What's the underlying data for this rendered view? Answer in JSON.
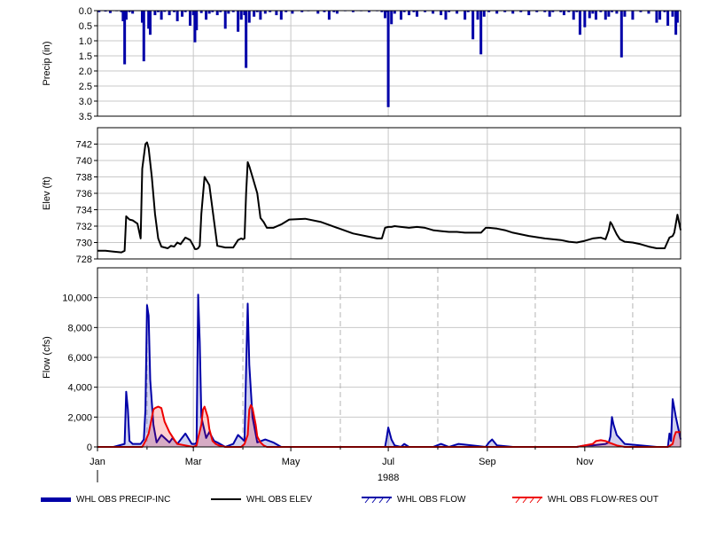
{
  "chart_data": {
    "type": "line",
    "x_axis": {
      "year_label": "1988",
      "tick_labels": [
        "Jan",
        "Mar",
        "May",
        "Jul",
        "Sep",
        "Nov"
      ],
      "tick_days": [
        0,
        60,
        121,
        182,
        244,
        305
      ],
      "minor_tick_days": [
        31,
        91,
        152,
        213,
        274,
        335
      ],
      "range_days": [
        0,
        365
      ]
    },
    "panels": [
      {
        "id": "precip",
        "ylabel": "Precip (in)",
        "ylim": [
          0,
          3.5
        ],
        "inverted": true,
        "yticks": [
          "0.0",
          "0.5",
          "1.0",
          "1.5",
          "2.0",
          "2.5",
          "3.0",
          "3.5"
        ],
        "ytick_values": [
          0,
          0.5,
          1,
          1.5,
          2,
          2.5,
          3,
          3.5
        ],
        "grid": true,
        "series": [
          {
            "name": "WHL OBS PRECIP-INC",
            "color": "#0000a8",
            "kind": "bar",
            "x": [
              1,
              5,
              8,
              12,
              15,
              16,
              17,
              18,
              20,
              22,
              28,
              29,
              32,
              33,
              36,
              38,
              40,
              42,
              45,
              48,
              50,
              53,
              55,
              58,
              60,
              61,
              62,
              65,
              68,
              70,
              72,
              75,
              77,
              80,
              82,
              85,
              88,
              90,
              92,
              93,
              95,
              98,
              100,
              102,
              105,
              108,
              112,
              115,
              118,
              122,
              128,
              132,
              138,
              142,
              145,
              148,
              150,
              155,
              160,
              165,
              170,
              175,
              178,
              180,
              181,
              182,
              184,
              186,
              190,
              192,
              195,
              198,
              200,
              205,
              210,
              215,
              218,
              220,
              225,
              230,
              232,
              235,
              238,
              240,
              242,
              245,
              250,
              255,
              260,
              265,
              270,
              275,
              280,
              283,
              285,
              290,
              292,
              295,
              298,
              300,
              302,
              305,
              308,
              310,
              312,
              315,
              318,
              320,
              322,
              325,
              328,
              330,
              335,
              340,
              345,
              350,
              352,
              355,
              357,
              360,
              362,
              363
            ],
            "y": [
              0.05,
              0.03,
              0.08,
              0.02,
              0.05,
              0.35,
              1.78,
              0.3,
              0.05,
              0.1,
              0.4,
              1.68,
              0.6,
              0.8,
              0.15,
              0.05,
              0.3,
              0.04,
              0.15,
              0.05,
              0.35,
              0.2,
              0.05,
              0.5,
              0.15,
              1.05,
              0.65,
              0.08,
              0.3,
              0.1,
              0.05,
              0.15,
              0.05,
              0.6,
              0.1,
              0.05,
              0.7,
              0.3,
              0.15,
              1.9,
              0.4,
              0.2,
              0.05,
              0.3,
              0.1,
              0.05,
              0.15,
              0.3,
              0.05,
              0.1,
              0.05,
              0.02,
              0.1,
              0.05,
              0.3,
              0.05,
              0.1,
              0.02,
              0.05,
              0.02,
              0.05,
              0.02,
              0.05,
              0.25,
              0.05,
              3.2,
              0.45,
              0.1,
              0.3,
              0.05,
              0.15,
              0.05,
              0.2,
              0.05,
              0.1,
              0.15,
              0.3,
              0.05,
              0.1,
              0.3,
              0.05,
              0.95,
              0.3,
              1.45,
              0.2,
              0.05,
              0.1,
              0.05,
              0.1,
              0.05,
              0.15,
              0.05,
              0.05,
              0.2,
              0.05,
              0.05,
              0.15,
              0.05,
              0.3,
              0.05,
              0.8,
              0.55,
              0.25,
              0.1,
              0.3,
              0.05,
              0.3,
              0.2,
              0.05,
              0.1,
              1.55,
              0.2,
              0.3,
              0.05,
              0.1,
              0.4,
              0.3,
              0.05,
              0.5,
              0.2,
              0.8,
              0.4,
              0.2,
              0.15
            ]
          }
        ]
      },
      {
        "id": "elev",
        "ylabel": "Elev (ft)",
        "ylim": [
          728,
          744
        ],
        "yticks": [
          "728",
          "730",
          "732",
          "734",
          "736",
          "738",
          "740",
          "742"
        ],
        "ytick_values": [
          728,
          730,
          732,
          734,
          736,
          738,
          740,
          742
        ],
        "grid": true,
        "series": [
          {
            "name": "WHL OBS ELEV",
            "color": "#000000",
            "kind": "line",
            "x": [
              0,
              5,
              10,
              15,
              17,
              18,
              20,
              22,
              25,
              27,
              28,
              30,
              31,
              32,
              34,
              36,
              38,
              40,
              44,
              46,
              48,
              50,
              52,
              55,
              58,
              60,
              61,
              62,
              63,
              64,
              65,
              67,
              70,
              75,
              80,
              83,
              85,
              88,
              90,
              91,
              92,
              93,
              94,
              95,
              97,
              100,
              102,
              104,
              106,
              110,
              115,
              120,
              130,
              140,
              150,
              160,
              170,
              175,
              178,
              180,
              182,
              184,
              186,
              190,
              195,
              200,
              205,
              210,
              215,
              220,
              225,
              230,
              240,
              243,
              245,
              250,
              255,
              260,
              270,
              280,
              290,
              295,
              300,
              305,
              310,
              315,
              318,
              320,
              321,
              322,
              323,
              325,
              327,
              330,
              335,
              340,
              345,
              350,
              355,
              358,
              360,
              361,
              363,
              365
            ],
            "y": [
              729.0,
              729.0,
              728.9,
              728.8,
              729.0,
              733.2,
              732.8,
              732.7,
              732.3,
              730.5,
              739.0,
              742.0,
              742.2,
              741.5,
              738.0,
              733.5,
              730.5,
              729.5,
              729.3,
              729.6,
              729.5,
              730.0,
              729.8,
              730.6,
              730.3,
              729.6,
              729.2,
              729.2,
              729.3,
              729.6,
              733.5,
              738.0,
              737.0,
              729.6,
              729.4,
              729.4,
              729.4,
              730.3,
              730.5,
              730.4,
              730.5,
              736.0,
              739.8,
              739.3,
              738.0,
              736.0,
              733.0,
              732.5,
              731.8,
              731.8,
              732.2,
              732.8,
              732.9,
              732.5,
              731.8,
              731.1,
              730.7,
              730.5,
              730.5,
              731.8,
              731.9,
              731.9,
              732.0,
              731.9,
              731.8,
              731.9,
              731.8,
              731.5,
              731.4,
              731.3,
              731.3,
              731.2,
              731.2,
              731.8,
              731.8,
              731.7,
              731.5,
              731.2,
              730.8,
              730.5,
              730.3,
              730.1,
              730.0,
              730.2,
              730.5,
              730.6,
              730.4,
              731.5,
              732.5,
              732.2,
              731.8,
              731.0,
              730.4,
              730.1,
              730.0,
              729.8,
              729.5,
              729.3,
              729.3,
              730.6,
              730.8,
              731.2,
              733.4,
              731.5
            ]
          }
        ]
      },
      {
        "id": "flow",
        "ylabel": "Flow (cfs)",
        "ylim": [
          0,
          12000
        ],
        "yticks": [
          "0",
          "2,000",
          "4,000",
          "6,000",
          "8,000",
          "10,000"
        ],
        "ytick_values": [
          0,
          2000,
          4000,
          6000,
          8000,
          10000
        ],
        "grid": true,
        "series": [
          {
            "name": "WHL OBS FLOW",
            "color": "#0000a8",
            "kind": "line",
            "x": [
              0,
              10,
              17,
              18,
              19,
              20,
              22,
              27,
              29,
              30,
              31,
              32,
              33,
              35,
              37,
              40,
              45,
              47,
              50,
              55,
              59,
              61,
              62,
              63,
              64,
              65,
              68,
              70,
              73,
              75,
              80,
              85,
              88,
              90,
              92,
              93,
              94,
              95,
              97,
              100,
              105,
              110,
              115,
              120,
              130,
              140,
              150,
              170,
              180,
              181,
              182,
              184,
              186,
              190,
              192,
              195,
              210,
              215,
              220,
              226,
              243,
              245,
              247,
              250,
              260,
              290,
              300,
              305,
              310,
              318,
              320,
              321,
              322,
              323,
              325,
              330,
              350,
              357,
              358,
              359,
              360,
              362,
              365
            ],
            "y": [
              0,
              0,
              200,
              3700,
              2500,
              400,
              200,
              200,
              500,
              2500,
              9500,
              8800,
              4500,
              1500,
              300,
              800,
              300,
              600,
              200,
              900,
              200,
              200,
              300,
              10200,
              7000,
              2000,
              600,
              1000,
              400,
              300,
              0,
              200,
              800,
              600,
              400,
              5200,
              9600,
              5500,
              2000,
              300,
              500,
              300,
              0,
              0,
              0,
              0,
              0,
              0,
              0,
              600,
              1300,
              500,
              100,
              0,
              200,
              0,
              0,
              200,
              0,
              200,
              0,
              300,
              500,
              100,
              0,
              0,
              0,
              100,
              100,
              200,
              300,
              700,
              2000,
              1500,
              800,
              200,
              0,
              0,
              900,
              400,
              3200,
              2000,
              500
            ]
          },
          {
            "name": "WHL OBS FLOW-RES OUT",
            "color": "#ee0000",
            "kind": "line",
            "x": [
              0,
              28,
              30,
              32,
              35,
              36,
              38,
              40,
              42,
              45,
              48,
              50,
              55,
              60,
              62,
              63,
              65,
              66,
              67,
              69,
              70,
              72,
              74,
              76,
              80,
              90,
              92,
              94,
              95,
              96,
              97,
              99,
              100,
              102,
              104,
              106,
              110,
              115,
              120,
              180,
              220,
              260,
              300,
              310,
              312,
              315,
              318,
              320,
              325,
              330,
              350,
              357,
              360,
              361,
              362,
              365
            ],
            "y": [
              0,
              0,
              400,
              900,
              2500,
              2600,
              2700,
              2600,
              1700,
              1000,
              500,
              200,
              100,
              0,
              100,
              600,
              1500,
              2500,
              2700,
              2000,
              1200,
              400,
              200,
              100,
              0,
              0,
              200,
              800,
              2500,
              2800,
              2600,
              1500,
              700,
              300,
              100,
              0,
              0,
              0,
              0,
              0,
              0,
              0,
              0,
              200,
              400,
              450,
              400,
              300,
              100,
              0,
              0,
              0,
              200,
              700,
              1000,
              1000
            ]
          }
        ]
      }
    ],
    "legend": {
      "placement": "bottom",
      "entries": [
        "WHL OBS PRECIP-INC",
        "WHL OBS ELEV",
        "WHL OBS FLOW",
        "WHL OBS FLOW-RES OUT"
      ]
    }
  }
}
